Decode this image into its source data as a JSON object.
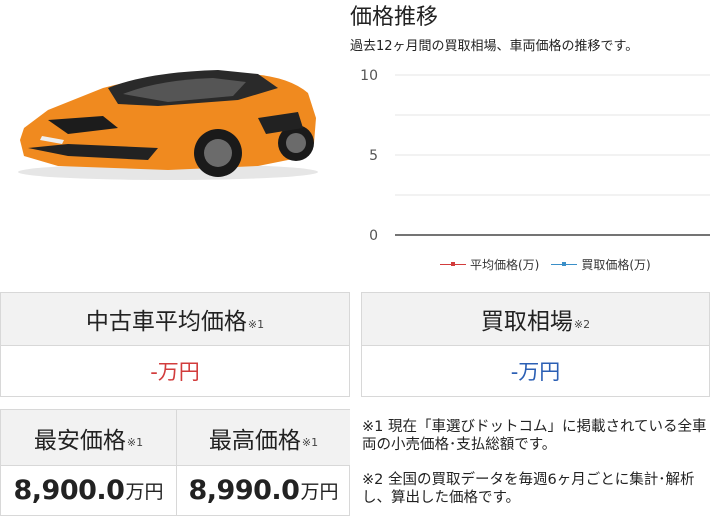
{
  "chart": {
    "title": "価格推移",
    "subtitle": "過去12ヶ月間の買取相場、車両価格の推移です。"
  },
  "chart_data": {
    "type": "line",
    "title": "価格推移",
    "x": [],
    "ylim": [
      0,
      10
    ],
    "yticks": [
      "10",
      "5",
      "0"
    ],
    "grid": true,
    "legend_position": "bottom",
    "series": [
      {
        "name": "平均価格(万)",
        "values": [],
        "color": "#d23c3c"
      },
      {
        "name": "買取価格(万)",
        "values": [],
        "color": "#3a8fc8"
      }
    ]
  },
  "avg_price": {
    "label": "中古車平均価格",
    "note": "※1",
    "value": "-万円"
  },
  "buy_price": {
    "label": "買取相場",
    "note": "※2",
    "value": "-万円"
  },
  "min_price": {
    "label": "最安価格",
    "note": "※1",
    "value": "8,900.0",
    "unit": "万円"
  },
  "max_price": {
    "label": "最高価格",
    "note": "※1",
    "value": "8,990.0",
    "unit": "万円"
  },
  "notes": [
    "※1 現在「車選びドットコム」に掲載されている全車両の小売価格･支払総額です。",
    "※2 全国の買取データを毎週6ヶ月ごとに集計･解析し、算出した価格です。"
  ],
  "colors": {
    "avg": "#d23c3c",
    "buy": "#2b5fb4",
    "header_bg": "#f2f2f2"
  },
  "image": {
    "car": "orange-lamborghini-revuelto"
  }
}
